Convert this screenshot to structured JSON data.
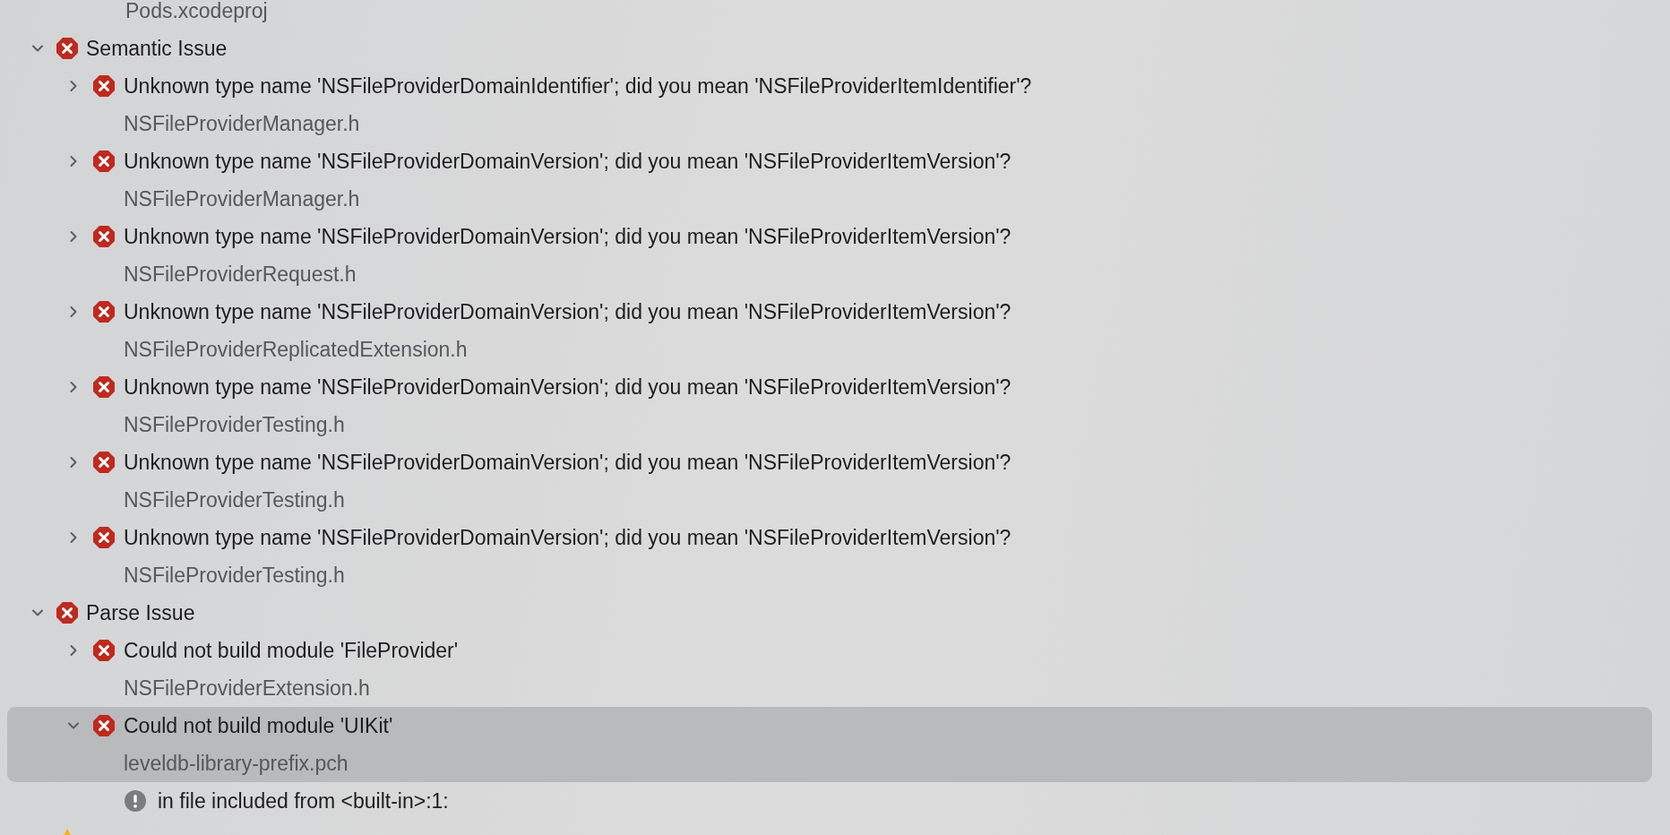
{
  "top_file": "Pods.xcodeproj",
  "groups": [
    {
      "kind": "error",
      "title": "Semantic Issue",
      "expanded": true,
      "items": [
        {
          "kind": "error",
          "message": "Unknown type name 'NSFileProviderDomainIdentifier'; did you mean 'NSFileProviderItemIdentifier'?",
          "file": "NSFileProviderManager.h",
          "expanded": false,
          "selected": false
        },
        {
          "kind": "error",
          "message": "Unknown type name 'NSFileProviderDomainVersion'; did you mean 'NSFileProviderItemVersion'?",
          "file": "NSFileProviderManager.h",
          "expanded": false,
          "selected": false
        },
        {
          "kind": "error",
          "message": "Unknown type name 'NSFileProviderDomainVersion'; did you mean 'NSFileProviderItemVersion'?",
          "file": "NSFileProviderRequest.h",
          "expanded": false,
          "selected": false
        },
        {
          "kind": "error",
          "message": "Unknown type name 'NSFileProviderDomainVersion'; did you mean 'NSFileProviderItemVersion'?",
          "file": "NSFileProviderReplicatedExtension.h",
          "expanded": false,
          "selected": false
        },
        {
          "kind": "error",
          "message": "Unknown type name 'NSFileProviderDomainVersion'; did you mean 'NSFileProviderItemVersion'?",
          "file": "NSFileProviderTesting.h",
          "expanded": false,
          "selected": false
        },
        {
          "kind": "error",
          "message": "Unknown type name 'NSFileProviderDomainVersion'; did you mean 'NSFileProviderItemVersion'?",
          "file": "NSFileProviderTesting.h",
          "expanded": false,
          "selected": false
        },
        {
          "kind": "error",
          "message": "Unknown type name 'NSFileProviderDomainVersion'; did you mean 'NSFileProviderItemVersion'?",
          "file": "NSFileProviderTesting.h",
          "expanded": false,
          "selected": false
        }
      ]
    },
    {
      "kind": "error",
      "title": "Parse Issue",
      "expanded": true,
      "items": [
        {
          "kind": "error",
          "message": "Could not build module 'FileProvider'",
          "file": "NSFileProviderExtension.h",
          "expanded": false,
          "selected": false
        },
        {
          "kind": "error",
          "message": "Could not build module 'UIKit'",
          "file": "leveldb-library-prefix.pch",
          "expanded": true,
          "selected": true,
          "children": [
            {
              "kind": "note",
              "message": "in file included from <built-in>:1:"
            }
          ]
        }
      ]
    },
    {
      "kind": "warning"
    }
  ]
}
